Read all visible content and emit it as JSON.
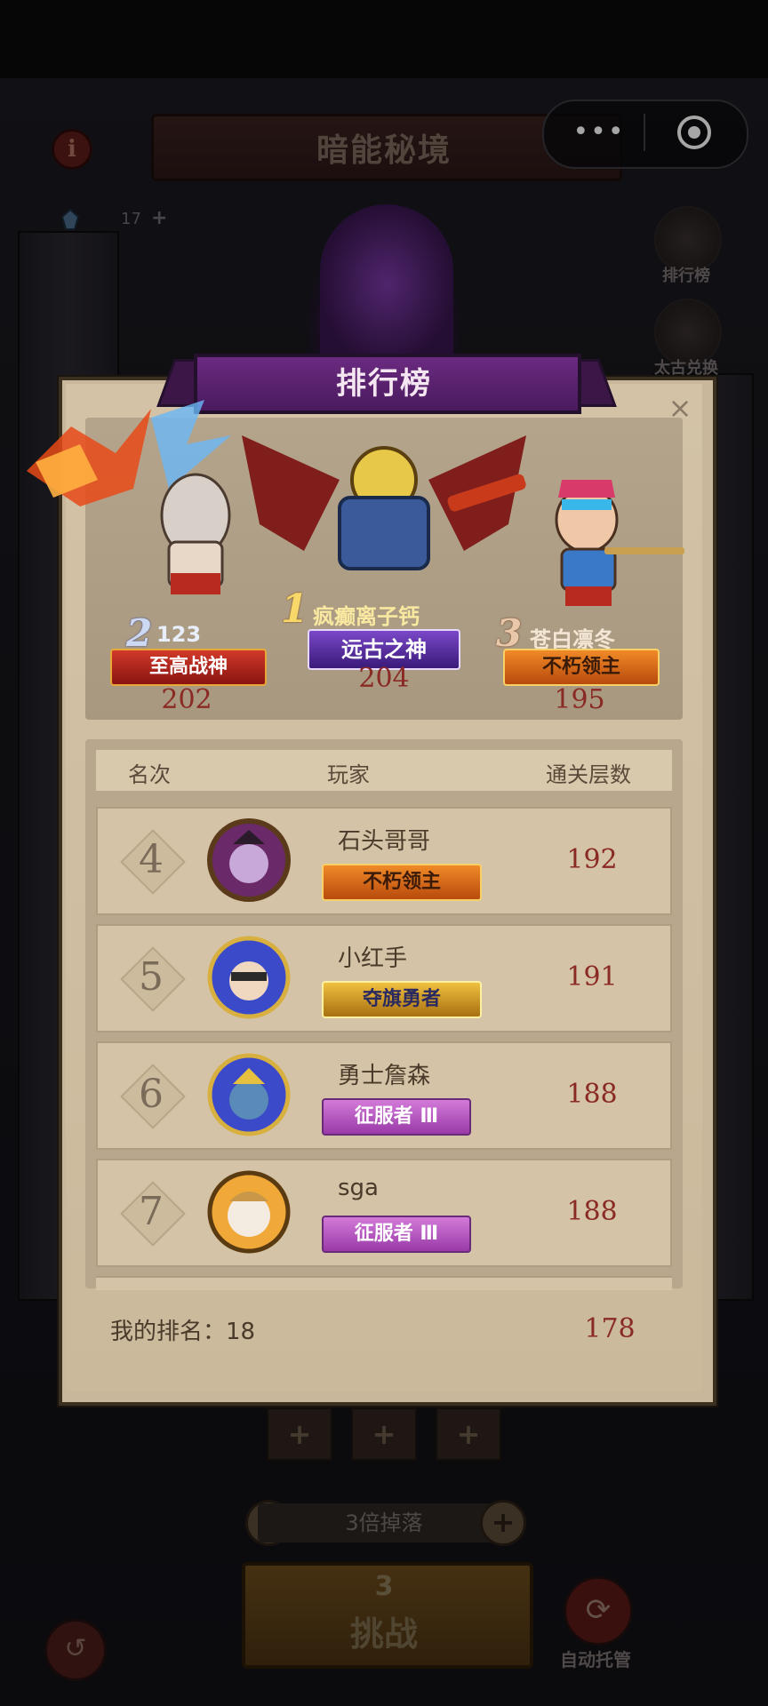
{
  "capsule": {
    "more_icon": "more-dots-icon",
    "close_icon": "target-circle-icon",
    "more_text": "•••"
  },
  "background": {
    "title": "暗能秘境",
    "info_label": "i",
    "energy_count": "17",
    "energy_plus": "+",
    "side_buttons": [
      {
        "label": "排行榜",
        "icon": "ranking-icon"
      },
      {
        "label": "太古兑换",
        "icon": "skull-exchange-icon"
      }
    ],
    "slot_plus": "+",
    "minus": "−",
    "plus": "+",
    "multiplier": "3倍掉落",
    "challenge_cost": "3",
    "challenge_label": "挑战",
    "back_glyph": "↺",
    "auto_glyph": "⟳",
    "auto_label": "自动托管"
  },
  "leaderboard": {
    "title": "排行榜",
    "close_glyph": "×",
    "podium": [
      {
        "rank": "2",
        "name": "123",
        "badge": "至高战神",
        "score": "202"
      },
      {
        "rank": "1",
        "name": "疯癫离子钙",
        "badge": "远古之神",
        "score": "204"
      },
      {
        "rank": "3",
        "name": "苍白凛冬",
        "badge": "不朽领主",
        "score": "195"
      }
    ],
    "headers": {
      "rank": "名次",
      "player": "玩家",
      "floors": "通关层数"
    },
    "rows": [
      {
        "rank": "4",
        "name": "石头哥哥",
        "badge": "不朽领主",
        "score": "192"
      },
      {
        "rank": "5",
        "name": "小红手",
        "badge": "夺旗勇者",
        "score": "191"
      },
      {
        "rank": "6",
        "name": "勇士詹森",
        "badge": "征服者 Ⅲ",
        "score": "188"
      },
      {
        "rank": "7",
        "name": "sga",
        "badge": "征服者 Ⅲ",
        "score": "188"
      }
    ],
    "my_rank_label": "我的排名：18",
    "my_score": "178"
  },
  "colors": {
    "panel": "#c9b79c",
    "score": "#8a2a24",
    "banner": "#5a2070"
  }
}
